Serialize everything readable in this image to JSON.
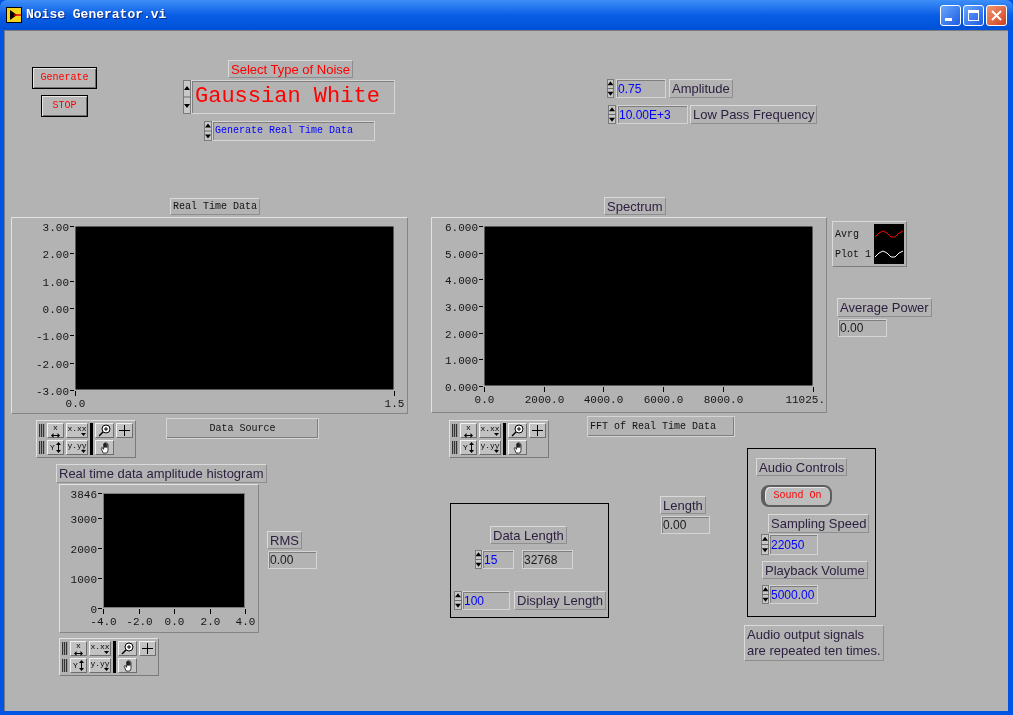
{
  "window": {
    "title": "Noise Generator.vi"
  },
  "buttons": [
    {
      "label": "Generate"
    },
    {
      "label": "STOP"
    }
  ],
  "noise_type": {
    "label": "Select Type of Noise",
    "value": "Gaussian White"
  },
  "data_mode": {
    "value": "Generate Real Time Data"
  },
  "amplitude": {
    "value": "0.75",
    "label": "Amplitude"
  },
  "low_pass_frequency": {
    "value": "10.00E+3",
    "label": "Low Pass Frequency"
  },
  "real_time_graph": {
    "label": "Real Time Data",
    "chart_data": {
      "type": "line",
      "xlim": [
        0,
        1.5
      ],
      "ylim": [
        -3,
        3
      ],
      "xticks": [
        {
          "value": 0,
          "label": "0.0"
        },
        {
          "value": 1.5,
          "label": "1.5"
        }
      ],
      "yticks": [
        {
          "value": 3,
          "label": "3.00"
        },
        {
          "value": 2,
          "label": "2.00"
        },
        {
          "value": 1,
          "label": "1.00"
        },
        {
          "value": 0,
          "label": "0.00"
        },
        {
          "value": -1,
          "label": "-1.00"
        },
        {
          "value": -2,
          "label": "-2.00"
        },
        {
          "value": -3,
          "label": "-3.00"
        }
      ]
    },
    "palette": {
      "x_axis": "x",
      "x_format": "x.xx",
      "y_axis": "Y",
      "y_format": "y.yy"
    },
    "source": "Data Source"
  },
  "spectrum_graph": {
    "label": "Spectrum",
    "chart_data": {
      "type": "line",
      "xlim": [
        0,
        11025
      ],
      "ylim": [
        0,
        6
      ],
      "xticks": [
        {
          "value": 0,
          "label": "0.0"
        },
        {
          "value": 2000,
          "label": "2000.0"
        },
        {
          "value": 4000,
          "label": "4000.0"
        },
        {
          "value": 6000,
          "label": "6000.0"
        },
        {
          "value": 8000,
          "label": "8000.0"
        },
        {
          "value": 11025,
          "label": "11025."
        }
      ],
      "yticks": [
        {
          "value": 6,
          "label": "6.000"
        },
        {
          "value": 5,
          "label": "5.000"
        },
        {
          "value": 4,
          "label": "4.000"
        },
        {
          "value": 3,
          "label": "3.000"
        },
        {
          "value": 2,
          "label": "2.000"
        },
        {
          "value": 1,
          "label": "1.000"
        },
        {
          "value": 0,
          "label": "0.000"
        }
      ]
    },
    "legend": [
      {
        "name": "Avrg",
        "color": "#ff0000"
      },
      {
        "name": "Plot 1",
        "color": "#ffffff"
      }
    ],
    "palette": {
      "x_axis": "x",
      "x_format": "x.xx",
      "y_axis": "Y",
      "y_format": "y.yy"
    },
    "caption": "FFT of Real Time Data"
  },
  "average_power": {
    "label": "Average Power",
    "value": "0.00"
  },
  "histogram": {
    "label": "Real time data amplitude histogram",
    "chart_data": {
      "type": "bar",
      "xlim": [
        -4,
        4
      ],
      "ylim": [
        0,
        3846
      ],
      "xticks": [
        {
          "value": -4,
          "label": "-4.0"
        },
        {
          "value": -2,
          "label": "-2.0"
        },
        {
          "value": 0,
          "label": "0.0"
        },
        {
          "value": 2,
          "label": "2.0"
        },
        {
          "value": 4,
          "label": "4.0"
        }
      ],
      "yticks": [
        0,
        1000,
        2000,
        3000,
        3846
      ]
    },
    "palette": {
      "x_axis": "x",
      "x_format": "x.xx",
      "y_axis": "Y",
      "y_format": "y.yy"
    }
  },
  "rms": {
    "label": "RMS",
    "value": "0.00"
  },
  "data_length": {
    "label": "Data Length",
    "value": "15",
    "samples": "32768",
    "display_length": {
      "value": "100",
      "label": "Display Length"
    }
  },
  "length": {
    "label": "Length",
    "value": "0.00"
  },
  "audio_controls": {
    "label": "Audio Controls",
    "sound_button": "Sound On",
    "sampling_speed": {
      "label": "Sampling Speed",
      "value": "22050"
    },
    "playback_volume": {
      "label": "Playback Volume",
      "value": "5000.00"
    }
  },
  "note": "Audio output signals are repeated ten times."
}
